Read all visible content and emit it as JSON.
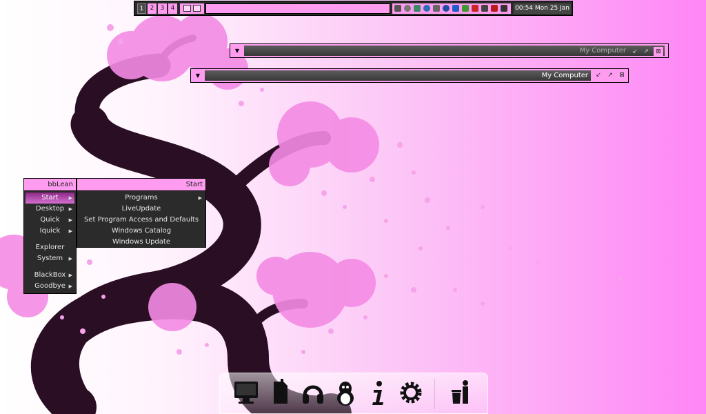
{
  "toolbar": {
    "workspaces": [
      "1",
      "2",
      "3",
      "4"
    ],
    "active_workspace": "1",
    "clock": "00:54 Mon 25 Jan",
    "tray_icons": [
      "usb-icon",
      "sync-icon",
      "display-icon",
      "globe-icon",
      "monitor-icon",
      "info-icon",
      "bluetooth-icon",
      "app-icon",
      "volume-icon",
      "network-icon",
      "x-icon",
      "window-icon"
    ]
  },
  "windows": [
    {
      "title": "My Computer",
      "active": false
    },
    {
      "title": "My Computer",
      "active": true
    }
  ],
  "bbmenu": {
    "title": "bbLean",
    "items": [
      {
        "label": "Start",
        "submenu": true,
        "selected": true
      },
      {
        "label": "Desktop",
        "submenu": true
      },
      {
        "label": "Quick",
        "submenu": true
      },
      {
        "label": "Iquick",
        "submenu": true
      },
      {
        "label": "Explorer",
        "submenu": false
      },
      {
        "label": "System",
        "submenu": true
      },
      {
        "label": "BlackBox",
        "submenu": true
      },
      {
        "label": "Goodbye",
        "submenu": true
      }
    ]
  },
  "startmenu": {
    "title": "Start",
    "items": [
      {
        "label": "Programs",
        "submenu": true
      },
      {
        "label": "LiveUpdate",
        "submenu": false
      },
      {
        "label": "Set Program Access and Defaults",
        "submenu": false
      },
      {
        "label": "Windows Catalog",
        "submenu": false
      },
      {
        "label": "Windows Update",
        "submenu": false
      }
    ]
  },
  "dock": {
    "items": [
      "monitor-icon",
      "document-icon",
      "headphones-icon",
      "penguin-icon",
      "info-icon",
      "settings-gear-icon",
      "trash-icon"
    ]
  },
  "colors": {
    "accent_pink": "#ff9cf0",
    "bar_dark": "#2b2b2b",
    "selection": "#c55abf",
    "tree": "#2a0f24",
    "blossom": "#f48be4"
  }
}
